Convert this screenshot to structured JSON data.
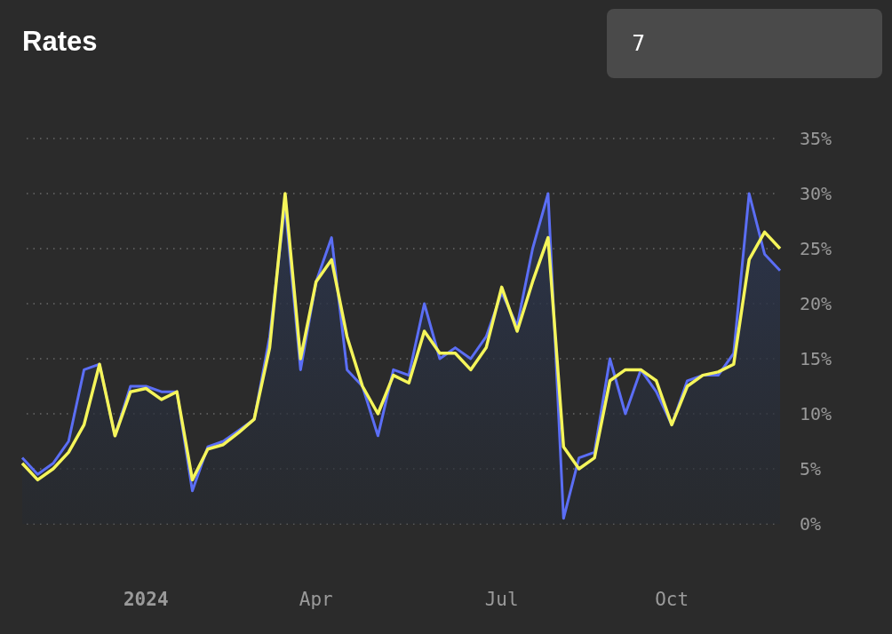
{
  "title": "Rates",
  "input": {
    "value": "7"
  },
  "chart": {
    "chart_data": {
      "type": "area",
      "grid": true,
      "categories": [
        null,
        null,
        null,
        null,
        null,
        null,
        null,
        null,
        "2024",
        null,
        null,
        null,
        null,
        null,
        null,
        null,
        null,
        null,
        null,
        "Apr",
        null,
        null,
        null,
        null,
        null,
        null,
        null,
        null,
        null,
        null,
        null,
        "Jul",
        null,
        null,
        null,
        null,
        null,
        null,
        null,
        null,
        null,
        null,
        "Oct",
        null,
        null,
        null,
        null,
        null,
        null,
        null
      ],
      "series": [
        {
          "type": "area",
          "color": "#5b6ef5",
          "values": [
            6,
            4.5,
            5.5,
            7.5,
            14,
            14.5,
            8,
            12.5,
            12.5,
            12,
            12,
            3,
            7,
            7.5,
            8.5,
            9.5,
            17,
            29,
            14,
            22,
            26,
            14,
            12.5,
            8,
            14,
            13.5,
            20,
            15,
            16,
            15,
            17,
            21,
            18,
            25,
            30,
            0.5,
            6,
            6.5,
            15,
            10,
            14,
            12,
            9,
            13,
            13.5,
            13.5,
            15.5,
            30,
            24.5,
            23
          ]
        },
        {
          "type": "line",
          "color": "#f5f55a",
          "values": [
            5.5,
            4,
            5,
            6.5,
            9,
            14.5,
            8,
            12,
            12.3,
            11.3,
            12,
            4,
            6.8,
            7.2,
            8.3,
            9.5,
            16,
            30,
            15,
            22,
            24,
            17,
            12.5,
            10,
            13.5,
            12.8,
            17.5,
            15.5,
            15.5,
            14,
            16,
            21.5,
            17.5,
            22,
            26,
            7,
            5,
            6,
            13,
            14,
            14,
            13,
            9,
            12.5,
            13.5,
            13.8,
            14.5,
            24,
            26.5,
            25
          ]
        }
      ],
      "ylim": [
        0,
        35
      ],
      "yticks": [
        {
          "value": 0,
          "label": "0%"
        },
        {
          "value": 5,
          "label": "5%"
        },
        {
          "value": 10,
          "label": "10%"
        },
        {
          "value": 15,
          "label": "15%"
        },
        {
          "value": 20,
          "label": "20%"
        },
        {
          "value": 25,
          "label": "25%"
        },
        {
          "value": 30,
          "label": "30%"
        },
        {
          "value": 35,
          "label": "35%"
        }
      ]
    }
  }
}
